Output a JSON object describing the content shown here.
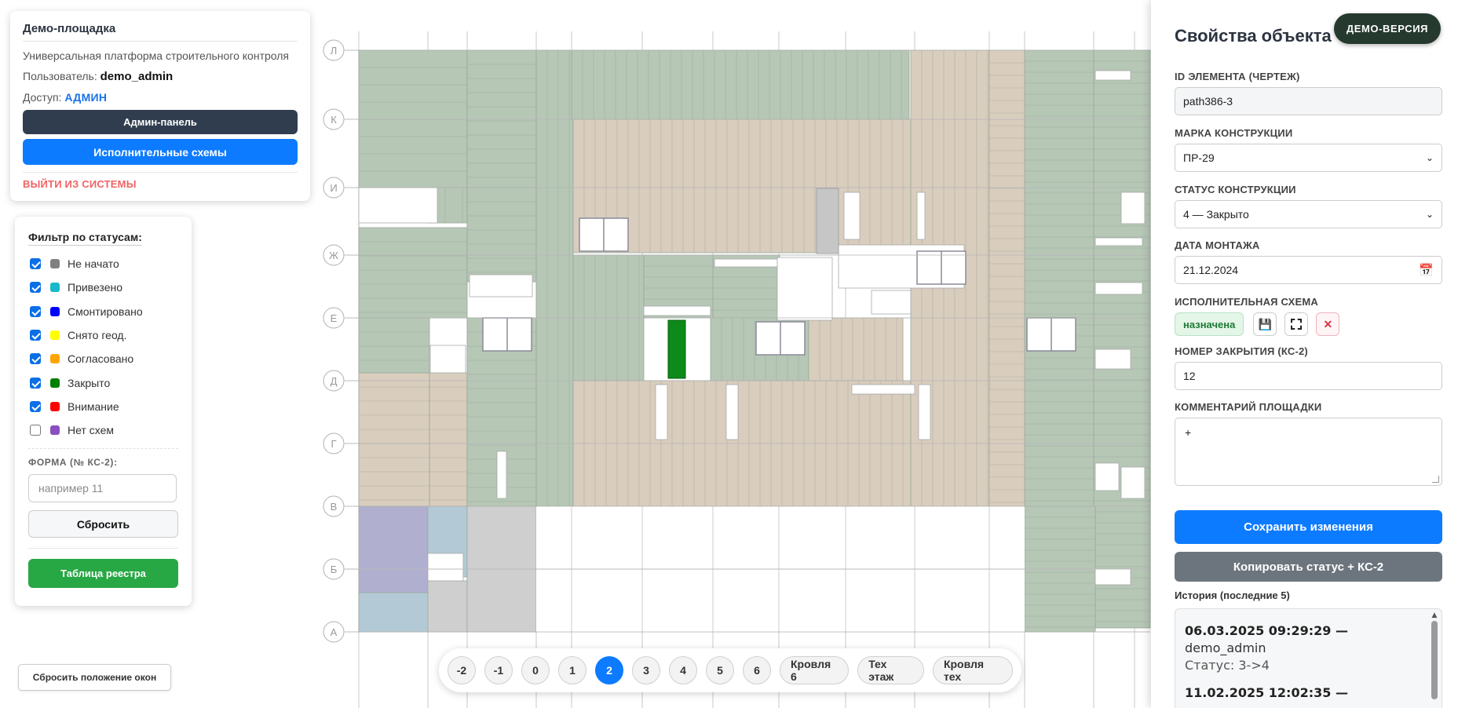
{
  "info": {
    "title": "Демо-площадка",
    "subtitle": "Универсальная платформа строительного контроля",
    "user_label": "Пользователь:",
    "user_value": "demo_admin",
    "access_label": "Доступ:",
    "access_value": "АДМИН",
    "admin_button": "Админ-панель",
    "schemes_button": "Исполнительные схемы",
    "logout": "ВЫЙТИ ИЗ СИСТЕМЫ"
  },
  "filter": {
    "title": "Фильтр по статусам:",
    "statuses": [
      {
        "label": "Не начато",
        "checked": true,
        "color": "#808080"
      },
      {
        "label": "Привезено",
        "checked": true,
        "color": "#17b8cc"
      },
      {
        "label": "Смонтировано",
        "checked": true,
        "color": "#0000ff"
      },
      {
        "label": "Снято геод.",
        "checked": true,
        "color": "#ffff00"
      },
      {
        "label": "Согласовано",
        "checked": true,
        "color": "#ffa500"
      },
      {
        "label": "Закрыто",
        "checked": true,
        "color": "#008000"
      },
      {
        "label": "Внимание",
        "checked": true,
        "color": "#ff0000"
      },
      {
        "label": "Нет схем",
        "checked": false,
        "color": "#8a4fbf"
      }
    ],
    "ks2_label": "ФОРМА (№ КС-2):",
    "ks2_placeholder": "например 11",
    "reset_button": "Сбросить",
    "registry_button": "Таблица реестра"
  },
  "reset_windows": "Сбросить положение окон",
  "floors": {
    "items": [
      "-2",
      "-1",
      "0",
      "1",
      "2",
      "3",
      "4",
      "5",
      "6",
      "Кровля 6",
      "Тех этаж",
      "Кровля тех"
    ],
    "active": "2"
  },
  "plan": {
    "axis_labels": [
      "Л",
      "К",
      "И",
      "Ж",
      "Е",
      "Д",
      "Г",
      "В",
      "Б",
      "А"
    ]
  },
  "props": {
    "title": "Свойства объекта",
    "demo_badge": "ДЕМО-ВЕРСИЯ",
    "id_label": "ID ЭЛЕМЕНТА (ЧЕРТЕЖ)",
    "id_value": "path386-3",
    "mark_label": "МАРКА КОНСТРУКЦИИ",
    "mark_value": "ПР-29",
    "status_label": "СТАТУС КОНСТРУКЦИИ",
    "status_value": "4 — Закрыто",
    "date_label": "ДАТА МОНТАЖА",
    "date_value": "21.12.2024",
    "scheme_label": "ИСПОЛНИТЕЛЬНАЯ СХЕМА",
    "scheme_status": "назначена",
    "ks2_label": "НОМЕР ЗАКРЫТИЯ (КС-2)",
    "ks2_value": "12",
    "comment_label": "КОММЕНТАРИЙ ПЛОЩАДКИ",
    "comment_value": "+",
    "save_button": "Сохранить изменения",
    "copy_button": "Копировать статус + КС-2",
    "history_title": "История (последние 5)",
    "history": [
      {
        "date": "06.03.2025 09:29:29 —",
        "user": "demo_admin",
        "status": "Статус: 3->4"
      },
      {
        "date": "11.02.2025 12:02:35 —",
        "user": "",
        "status": ""
      }
    ]
  },
  "colors": {
    "slab_green": "#b6c7b6",
    "slab_beige": "#d9cdbe",
    "slab_gray": "#cfcfcf",
    "slab_purple": "#b0afd0",
    "slab_lightblue": "#b3cad6",
    "closed_highlight": "#0d8a1a",
    "primary": "#0d7bff",
    "dark": "#2f3d4f"
  }
}
